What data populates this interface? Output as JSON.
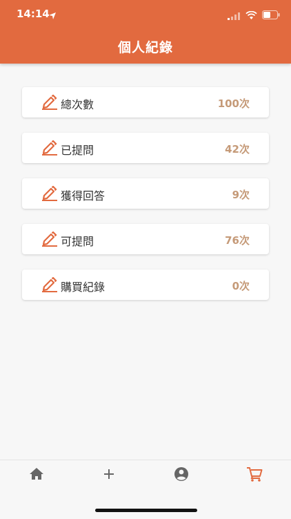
{
  "status_bar": {
    "time": "14:14"
  },
  "header": {
    "title": "個人紀錄"
  },
  "records": [
    {
      "label": "總次數",
      "value": "100次",
      "icon": "pencil-icon"
    },
    {
      "label": "已提問",
      "value": "42次",
      "icon": "pencil-icon"
    },
    {
      "label": "獲得回答",
      "value": "9次",
      "icon": "pencil-icon"
    },
    {
      "label": "可提問",
      "value": "76次",
      "icon": "pencil-icon"
    },
    {
      "label": "購買紀錄",
      "value": "0次",
      "icon": "pencil-icon"
    }
  ],
  "tabbar": {
    "tabs": [
      {
        "icon": "home-icon",
        "active": false
      },
      {
        "icon": "plus-icon",
        "active": false
      },
      {
        "icon": "account-icon",
        "active": false
      },
      {
        "icon": "cart-icon",
        "active": true
      }
    ]
  },
  "colors": {
    "accent": "#e26a3f",
    "value_text": "#c59a78",
    "background": "#f7f7f7",
    "tab_inactive": "#666666"
  }
}
